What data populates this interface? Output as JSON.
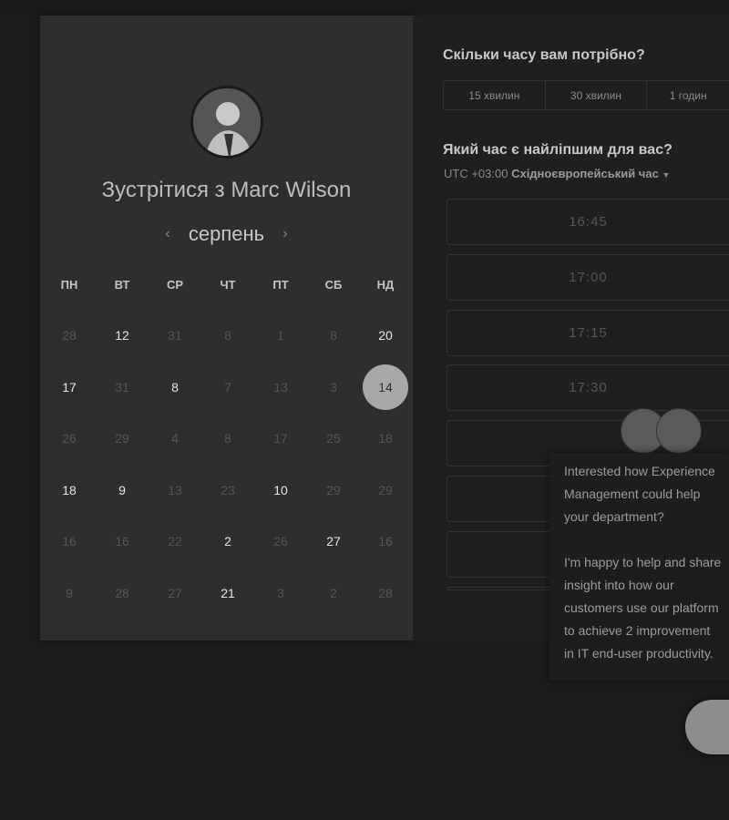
{
  "host": {
    "title_prefix": "Зустрітися з ",
    "name": "Marc Wilson"
  },
  "calendar": {
    "month": "серпень",
    "prev_icon": "chevron-left-icon",
    "next_icon": "chevron-right-icon",
    "weekdays": [
      "ПН",
      "ВТ",
      "СР",
      "ЧТ",
      "ПТ",
      "СБ",
      "НД"
    ],
    "rows": [
      [
        {
          "d": "28",
          "s": "dim"
        },
        {
          "d": "12",
          "s": "on"
        },
        {
          "d": "31",
          "s": "dim"
        },
        {
          "d": "8",
          "s": "dim"
        },
        {
          "d": "1",
          "s": "dim"
        },
        {
          "d": "8",
          "s": "dim"
        },
        {
          "d": "20",
          "s": "on"
        }
      ],
      [
        {
          "d": "17",
          "s": "on"
        },
        {
          "d": "31",
          "s": "dim"
        },
        {
          "d": "8",
          "s": "on"
        },
        {
          "d": "7",
          "s": "dim"
        },
        {
          "d": "13",
          "s": "dim"
        },
        {
          "d": "3",
          "s": "dim"
        },
        {
          "d": "14",
          "s": "sel"
        }
      ],
      [
        {
          "d": "26",
          "s": "dim"
        },
        {
          "d": "29",
          "s": "dim"
        },
        {
          "d": "4",
          "s": "dim"
        },
        {
          "d": "8",
          "s": "dim"
        },
        {
          "d": "17",
          "s": "dim"
        },
        {
          "d": "25",
          "s": "dim"
        },
        {
          "d": "18",
          "s": "dim"
        }
      ],
      [
        {
          "d": "18",
          "s": "on"
        },
        {
          "d": "9",
          "s": "on"
        },
        {
          "d": "13",
          "s": "dim"
        },
        {
          "d": "23",
          "s": "dim"
        },
        {
          "d": "10",
          "s": "on"
        },
        {
          "d": "29",
          "s": "dim"
        },
        {
          "d": "29",
          "s": "dim"
        }
      ],
      [
        {
          "d": "16",
          "s": "dim"
        },
        {
          "d": "16",
          "s": "dim"
        },
        {
          "d": "22",
          "s": "dim"
        },
        {
          "d": "2",
          "s": "on"
        },
        {
          "d": "26",
          "s": "dim"
        },
        {
          "d": "27",
          "s": "on"
        },
        {
          "d": "16",
          "s": "dim"
        }
      ],
      [
        {
          "d": "9",
          "s": "dim"
        },
        {
          "d": "28",
          "s": "dim"
        },
        {
          "d": "27",
          "s": "dim"
        },
        {
          "d": "21",
          "s": "on"
        },
        {
          "d": "3",
          "s": "dim"
        },
        {
          "d": "2",
          "s": "dim"
        },
        {
          "d": "28",
          "s": "dim"
        }
      ]
    ]
  },
  "duration": {
    "question": "Скільки часу вам потрібно?",
    "options": [
      "15 хвилин",
      "30 хвилин",
      "1 годин"
    ]
  },
  "time": {
    "question": "Який час є найліпшим для вас?",
    "tz_offset": "UTC +03:00",
    "tz_name": "Східноєвропейський час",
    "slots": [
      "16:45",
      "17:00",
      "17:15",
      "17:30",
      "",
      "",
      "",
      ""
    ]
  },
  "popup": {
    "line1": "Interested how Experience Management could help your department?",
    "line2": "I'm happy to help and share insight into how our customers use our platform to achieve 2 improvement in IT end-user productivity."
  }
}
